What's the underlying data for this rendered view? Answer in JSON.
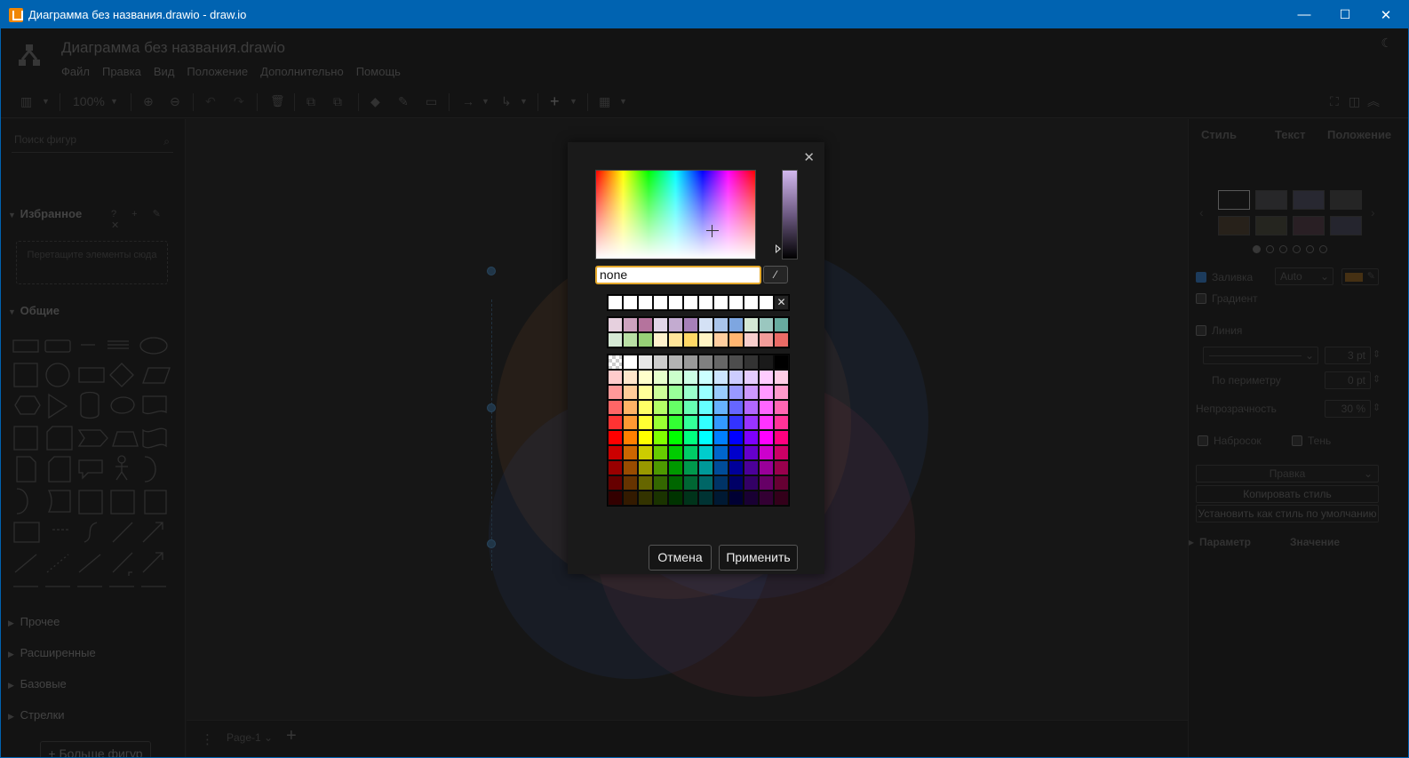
{
  "window": {
    "title": "Диаграмма без названия.drawio - draw.io",
    "min_glyph": "—",
    "max_glyph": "☐",
    "close_glyph": "✕"
  },
  "header": {
    "doc_title": "Диаграмма без названия.drawio",
    "menu": [
      "Файл",
      "Правка",
      "Вид",
      "Положение",
      "Дополнительно",
      "Помощь"
    ],
    "moon_glyph": "☾"
  },
  "toolbar": {
    "zoom": "100%",
    "panel_glyph": "▥",
    "zoom_in_glyph": "⊕",
    "zoom_out_glyph": "⊖",
    "undo_glyph": "↶",
    "redo_glyph": "↷",
    "delete_glyph": "🗑",
    "front_glyph": "⧉",
    "back_glyph": "⧉",
    "fill_glyph": "◆",
    "line_glyph": "✎",
    "shadow_glyph": "▭",
    "connection_glyph": "→",
    "waypoint_glyph": "↳",
    "insert_glyph": "+",
    "table_glyph": "▦",
    "fullscreen_glyph": "⛶",
    "format_glyph": "◫",
    "collapse_glyph": "︽"
  },
  "sidebar": {
    "search_placeholder": "Поиск фигур",
    "search_glyph": "⌕",
    "favorites": "Избранное",
    "favorites_tools": "? + ✎ ✕",
    "dropzone_text": "Перетащите элементы сюда",
    "general": "Общие",
    "collapsed_sections": [
      "Прочее",
      "Расширенные",
      "Базовые",
      "Стрелки"
    ],
    "more_shapes": "+ Больше фигур",
    "arrow_open": "▼",
    "arrow_closed": "▶"
  },
  "pagebar": {
    "menu_glyph": "⋮",
    "page_tab": "Page-1 ⌄",
    "add_glyph": "+"
  },
  "format": {
    "tabs": [
      "Стиль",
      "Текст",
      "Положение"
    ],
    "fill": "Заливка",
    "fill_mode": "Auto",
    "gradient": "Градиент",
    "line": "Линия",
    "line_width": "3 pt",
    "perimeter": "По периметру",
    "perimeter_value": "0 pt",
    "opacity": "Непрозрачность",
    "opacity_value": "30 %",
    "sketch": "Набросок",
    "shadow": "Тень",
    "edit_select": "Правка",
    "copy_style": "Копировать стиль",
    "set_default": "Установить как стиль по умолчанию",
    "param": "Параметр",
    "value": "Значение",
    "prev_glyph": "‹",
    "next_glyph": "›",
    "chevron_glyph": "⌄",
    "pencil_glyph": "✎",
    "spin_glyph": "⇕",
    "caret_glyph": "▸"
  },
  "color_dialog": {
    "hex_value": "none",
    "close_glyph": "✕",
    "eyedropper_glyph": "⁄",
    "clear_glyph": "✕",
    "cancel": "Отмена",
    "apply": "Применить",
    "recent": [
      "#ffffff",
      "#ffffff",
      "#ffffff",
      "#ffffff",
      "#ffffff",
      "#ffffff",
      "#ffffff",
      "#ffffff",
      "#ffffff",
      "#ffffff",
      "#ffffff",
      "none"
    ],
    "presets": [
      "#e6d0de",
      "#cda2be",
      "#b5739d",
      "#e1d5e7",
      "#c3abd0",
      "#a680b8",
      "#d4e1f5",
      "#a9c4eb",
      "#7ea6e0",
      "#d5e8d4",
      "#9ac7bf",
      "#67ab9f",
      "#d5e8d4",
      "#b9e0a5",
      "#97d077",
      "#fff2cc",
      "#ffe599",
      "#ffd966",
      "#fff4c3",
      "#ffce9f",
      "#ffb570",
      "#f8cecc",
      "#f19c99",
      "#ea6b66"
    ],
    "palette": [
      [
        "#ffffff",
        "#ffffff",
        "#e6e6e6",
        "#cccccc",
        "#b3b3b3",
        "#999999",
        "#808080",
        "#666666",
        "#4d4d4d",
        "#333333",
        "#1a1a1a",
        "#000000"
      ],
      [
        "#ffcccc",
        "#ffe6cc",
        "#ffffcc",
        "#e6ffcc",
        "#ccffcc",
        "#ccffe6",
        "#ccffff",
        "#cce5ff",
        "#ccccff",
        "#e5ccff",
        "#ffccff",
        "#ffcce6"
      ],
      [
        "#ff9999",
        "#ffcc99",
        "#ffff99",
        "#ccff99",
        "#99ff99",
        "#99ffcc",
        "#99ffff",
        "#99ccff",
        "#9999ff",
        "#cc99ff",
        "#ff99ff",
        "#ff99cc"
      ],
      [
        "#ff6666",
        "#ffb366",
        "#ffff66",
        "#b3ff66",
        "#66ff66",
        "#66ffb3",
        "#66ffff",
        "#66b2ff",
        "#6666ff",
        "#b266ff",
        "#ff66ff",
        "#ff66b3"
      ],
      [
        "#ff3333",
        "#ff9933",
        "#ffff33",
        "#99ff33",
        "#33ff33",
        "#33ff99",
        "#33ffff",
        "#3399ff",
        "#3333ff",
        "#9933ff",
        "#ff33ff",
        "#ff3399"
      ],
      [
        "#ff0000",
        "#ff8000",
        "#ffff00",
        "#80ff00",
        "#00ff00",
        "#00ff80",
        "#00ffff",
        "#007fff",
        "#0000ff",
        "#7f00ff",
        "#ff00ff",
        "#ff0080"
      ],
      [
        "#cc0000",
        "#cc6600",
        "#cccc00",
        "#66cc00",
        "#00cc00",
        "#00cc66",
        "#00cccc",
        "#0066cc",
        "#0000cc",
        "#6600cc",
        "#cc00cc",
        "#cc0066"
      ],
      [
        "#990000",
        "#994c00",
        "#999900",
        "#4d9900",
        "#009900",
        "#00994d",
        "#009999",
        "#004c99",
        "#000099",
        "#4c0099",
        "#990099",
        "#99004d"
      ],
      [
        "#660000",
        "#663300",
        "#666600",
        "#336600",
        "#006600",
        "#006633",
        "#006666",
        "#003366",
        "#000066",
        "#330066",
        "#660066",
        "#660033"
      ],
      [
        "#330000",
        "#331a00",
        "#333300",
        "#1a3300",
        "#003300",
        "#00331a",
        "#003333",
        "#001933",
        "#000033",
        "#190033",
        "#330033",
        "#33001a"
      ]
    ]
  }
}
